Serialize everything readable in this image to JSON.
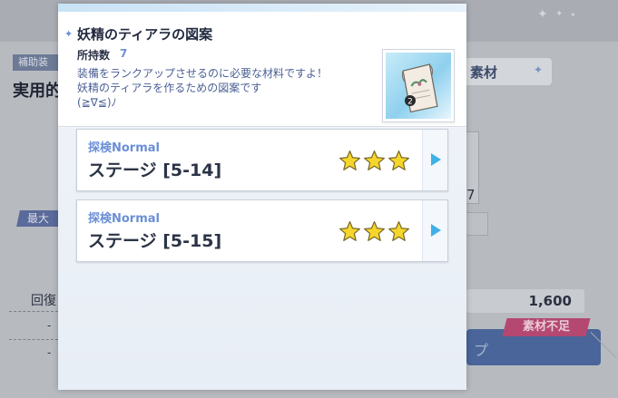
{
  "background": {
    "badge": "補助装",
    "title": "実用的",
    "tab_label": "素材",
    "side_number": "7",
    "max_label": "最大",
    "recover_label": "回復",
    "dash_value": "-",
    "quantity": "1,600",
    "shortage": "素材不足",
    "button_label": "プ"
  },
  "popup": {
    "title": "妖精のティアラの図案",
    "owned_label": "所持数",
    "owned_count": "7",
    "description": [
      "装備をランクアップさせるのに必要な材料ですよ！",
      "妖精のティアラを作るための図案です",
      "(≧∇≦)ﾉ"
    ],
    "item_icon": "blueprint-scroll-icon",
    "item_badge": "2",
    "stages": [
      {
        "mode": "探検Normal",
        "name": "ステージ [5-14]",
        "stars": 3,
        "max_stars": 3
      },
      {
        "mode": "探検Normal",
        "name": "ステージ [5-15]",
        "stars": 3,
        "max_stars": 3
      }
    ]
  },
  "colors": {
    "accent": "#6b8fd6",
    "star_fill": "#f6d62a",
    "arrow": "#3fb0e8",
    "shortage_badge": "#b44870"
  }
}
